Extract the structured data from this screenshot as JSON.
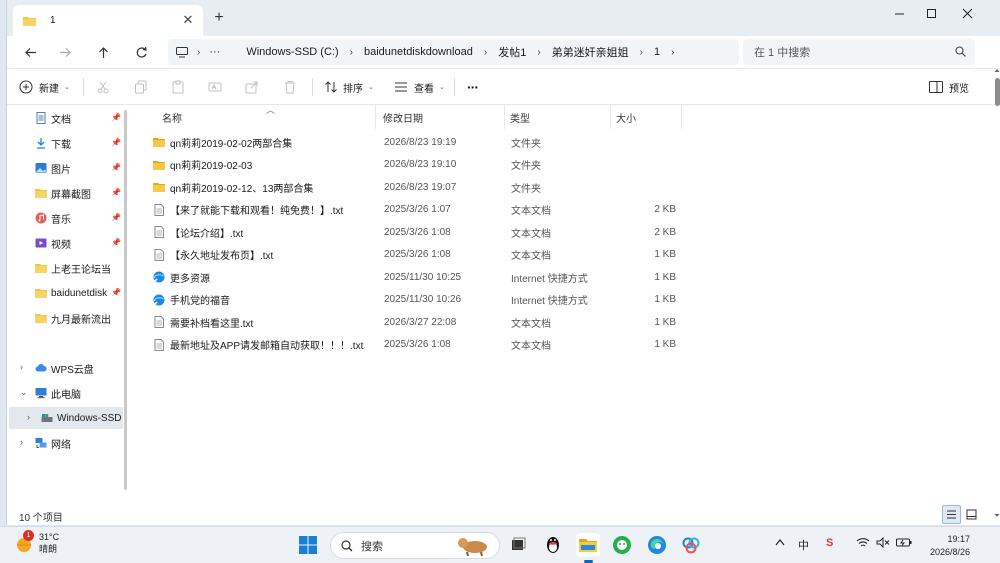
{
  "tab": {
    "title": "1",
    "close": "✕",
    "new": "+"
  },
  "window_controls": {
    "minimize": "—",
    "maximize": "☐",
    "close": "✕"
  },
  "breadcrumb": [
    "Windows-SSD (C:)",
    "baidunetdiskdownload",
    "发帖1",
    "弟弟迷奸亲姐姐",
    "1"
  ],
  "address_ellipsis": "···",
  "search": {
    "placeholder": "在 1 中搜索"
  },
  "toolbar": {
    "new_label": "新建",
    "sort_label": "排序",
    "view_label": "查看",
    "more_label": "···",
    "preview_label": "预览"
  },
  "sidebar": {
    "items": [
      {
        "label": "文档",
        "icon": "document-icon",
        "pinned": true
      },
      {
        "label": "下载",
        "icon": "download-icon",
        "pinned": true
      },
      {
        "label": "图片",
        "icon": "picture-icon",
        "pinned": true
      },
      {
        "label": "屏幕截图",
        "icon": "folder-icon",
        "pinned": true
      },
      {
        "label": "音乐",
        "icon": "music-icon",
        "pinned": true
      },
      {
        "label": "视频",
        "icon": "video-icon",
        "pinned": true
      },
      {
        "label": "上老王论坛当",
        "icon": "folder-icon",
        "pinned": false
      },
      {
        "label": "baidunetdisk",
        "icon": "folder-icon",
        "pinned": true
      },
      {
        "label": "九月最新流出",
        "icon": "folder-icon",
        "pinned": false
      }
    ],
    "tree": [
      {
        "label": "WPS云盘",
        "icon": "cloud-icon",
        "expander": "›"
      },
      {
        "label": "此电脑",
        "icon": "computer-icon",
        "expander": "⌄"
      },
      {
        "label": "Windows-SSD",
        "icon": "drive-icon",
        "expander": "›"
      },
      {
        "label": "网络",
        "icon": "network-icon",
        "expander": "›"
      }
    ]
  },
  "columns": {
    "name": "名称",
    "date": "修改日期",
    "type": "类型",
    "size": "大小"
  },
  "files": [
    {
      "name": "qn莉莉2019-02-02两部合集",
      "date": "2026/8/23 19:19",
      "type": "文件夹",
      "size": "",
      "icon": "folder"
    },
    {
      "name": "qn莉莉2019-02-03",
      "date": "2026/8/23 19:10",
      "type": "文件夹",
      "size": "",
      "icon": "folder"
    },
    {
      "name": "qn莉莉2019-02-12、13两部合集",
      "date": "2026/8/23 19:07",
      "type": "文件夹",
      "size": "",
      "icon": "folder"
    },
    {
      "name": "【来了就能下载和观看！纯免费！】.txt",
      "date": "2025/3/26 1:07",
      "type": "文本文档",
      "size": "2 KB",
      "icon": "text"
    },
    {
      "name": "【论坛介绍】.txt",
      "date": "2025/3/26 1:08",
      "type": "文本文档",
      "size": "2 KB",
      "icon": "text"
    },
    {
      "name": "【永久地址发布页】.txt",
      "date": "2025/3/26 1:08",
      "type": "文本文档",
      "size": "1 KB",
      "icon": "text"
    },
    {
      "name": "更多资源",
      "date": "2025/11/30 10:25",
      "type": "Internet 快捷方式",
      "size": "1 KB",
      "icon": "shortcut"
    },
    {
      "name": "手机党的福音",
      "date": "2025/11/30 10:26",
      "type": "Internet 快捷方式",
      "size": "1 KB",
      "icon": "shortcut"
    },
    {
      "name": "需要补档看这里.txt",
      "date": "2026/3/27 22:08",
      "type": "文本文档",
      "size": "1 KB",
      "icon": "text"
    },
    {
      "name": "最新地址及APP请发邮箱自动获取！！！.txt",
      "date": "2025/3/26 1:08",
      "type": "文本文档",
      "size": "1 KB",
      "icon": "text"
    }
  ],
  "status": {
    "item_count": "10 个项目"
  },
  "taskbar": {
    "weather_badge": "1",
    "weather_temp": "31°C",
    "weather_desc": "晴朗",
    "search_label": "搜索",
    "tray_ime_a": "中",
    "tray_ime_b": "S",
    "clock_time": "19:17",
    "clock_date": "2026/8/26"
  },
  "colors": {
    "folder": "#f4c542",
    "accent": "#0a64c8",
    "selected": "#e3e8ee"
  }
}
